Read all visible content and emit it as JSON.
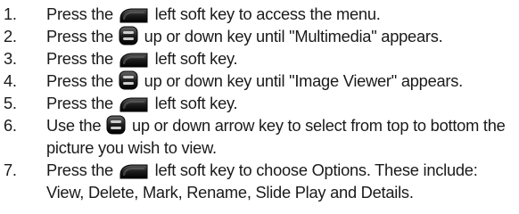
{
  "steps": [
    {
      "number": "1.",
      "before": "Press the",
      "icon": "left-soft-key-icon",
      "after": "left soft key to access the menu."
    },
    {
      "number": "2.",
      "before": "Press the",
      "icon": "navigation-key-icon",
      "after": "up or down key until \"Multimedia\" appears."
    },
    {
      "number": "3.",
      "before": "Press the",
      "icon": "left-soft-key-icon",
      "after": "left soft key."
    },
    {
      "number": "4.",
      "before": "Press the",
      "icon": "navigation-key-icon",
      "after": "up or down key until \"Image Viewer\" appears."
    },
    {
      "number": "5.",
      "before": "Press the",
      "icon": "left-soft-key-icon",
      "after": "left soft key."
    },
    {
      "number": "6.",
      "before": "Use the",
      "icon": "navigation-key-icon",
      "after": "up or down arrow key to select from top to bottom the picture you wish to view."
    },
    {
      "number": "7.",
      "before": "Press the",
      "icon": "left-soft-key-icon",
      "after": "left soft key to choose Options. These include: View, Delete, Mark, Rename, Slide Play and Details."
    }
  ]
}
